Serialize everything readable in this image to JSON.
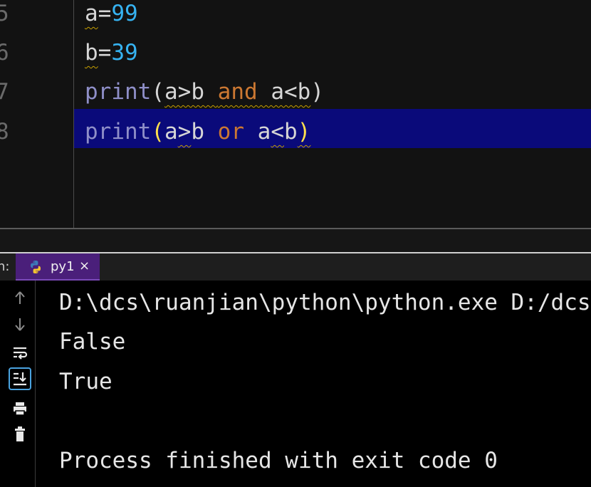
{
  "editor": {
    "gutter": [
      "5",
      "6",
      "7",
      "8"
    ],
    "lines": [
      {
        "tokens": [
          {
            "t": "a",
            "c": "tok-var"
          },
          {
            "t": "=",
            "c": "tok-plain"
          },
          {
            "t": "99",
            "c": "tok-num"
          }
        ]
      },
      {
        "tokens": [
          {
            "t": "b",
            "c": "tok-var"
          },
          {
            "t": "=",
            "c": "tok-plain"
          },
          {
            "t": "39",
            "c": "tok-num"
          }
        ]
      },
      {
        "tokens": [
          {
            "t": "print",
            "c": "tok-builtin"
          },
          {
            "t": "(",
            "c": "tok-paren"
          },
          {
            "t": "a>b ",
            "c": "tok-plain squiggle"
          },
          {
            "t": "and",
            "c": "tok-kw squiggle"
          },
          {
            "t": " a<b",
            "c": "tok-plain squiggle"
          },
          {
            "t": ")",
            "c": "tok-paren"
          }
        ]
      },
      {
        "tokens": [
          {
            "t": "print",
            "c": "tok-builtin"
          },
          {
            "t": "(",
            "c": "tok-paren-hl"
          },
          {
            "t": "a",
            "c": "tok-plain"
          },
          {
            "t": ">",
            "c": "tok-plain squiggle"
          },
          {
            "t": "b ",
            "c": "tok-plain"
          },
          {
            "t": "or",
            "c": "tok-kw"
          },
          {
            "t": " a",
            "c": "tok-plain"
          },
          {
            "t": "<",
            "c": "tok-plain squiggle"
          },
          {
            "t": "b",
            "c": "tok-plain"
          },
          {
            "t": ")",
            "c": "tok-paren-hl squiggle"
          }
        ]
      }
    ],
    "current_line_index": 3
  },
  "run_panel": {
    "label": "n:",
    "tab_label": "py1",
    "tab_close": "×"
  },
  "toolbar": [
    {
      "name": "up-arrow-icon"
    },
    {
      "name": "down-arrow-icon"
    },
    {
      "name": "soft-wrap-icon"
    },
    {
      "name": "scroll-to-end-icon",
      "active": true
    },
    {
      "name": "print-icon"
    },
    {
      "name": "trash-icon"
    }
  ],
  "console": {
    "lines": [
      "D:\\dcs\\ruanjian\\python\\python.exe D:/dcs",
      "False",
      "True",
      "",
      "Process finished with exit code 0"
    ]
  },
  "colors": {
    "editor_bg": "#121212",
    "current_line_bg": "#0a0a7a",
    "number": "#36b3f2",
    "keyword": "#cc7832",
    "builtin": "#8f8fc8",
    "tab_bg": "#4a1f7a"
  }
}
